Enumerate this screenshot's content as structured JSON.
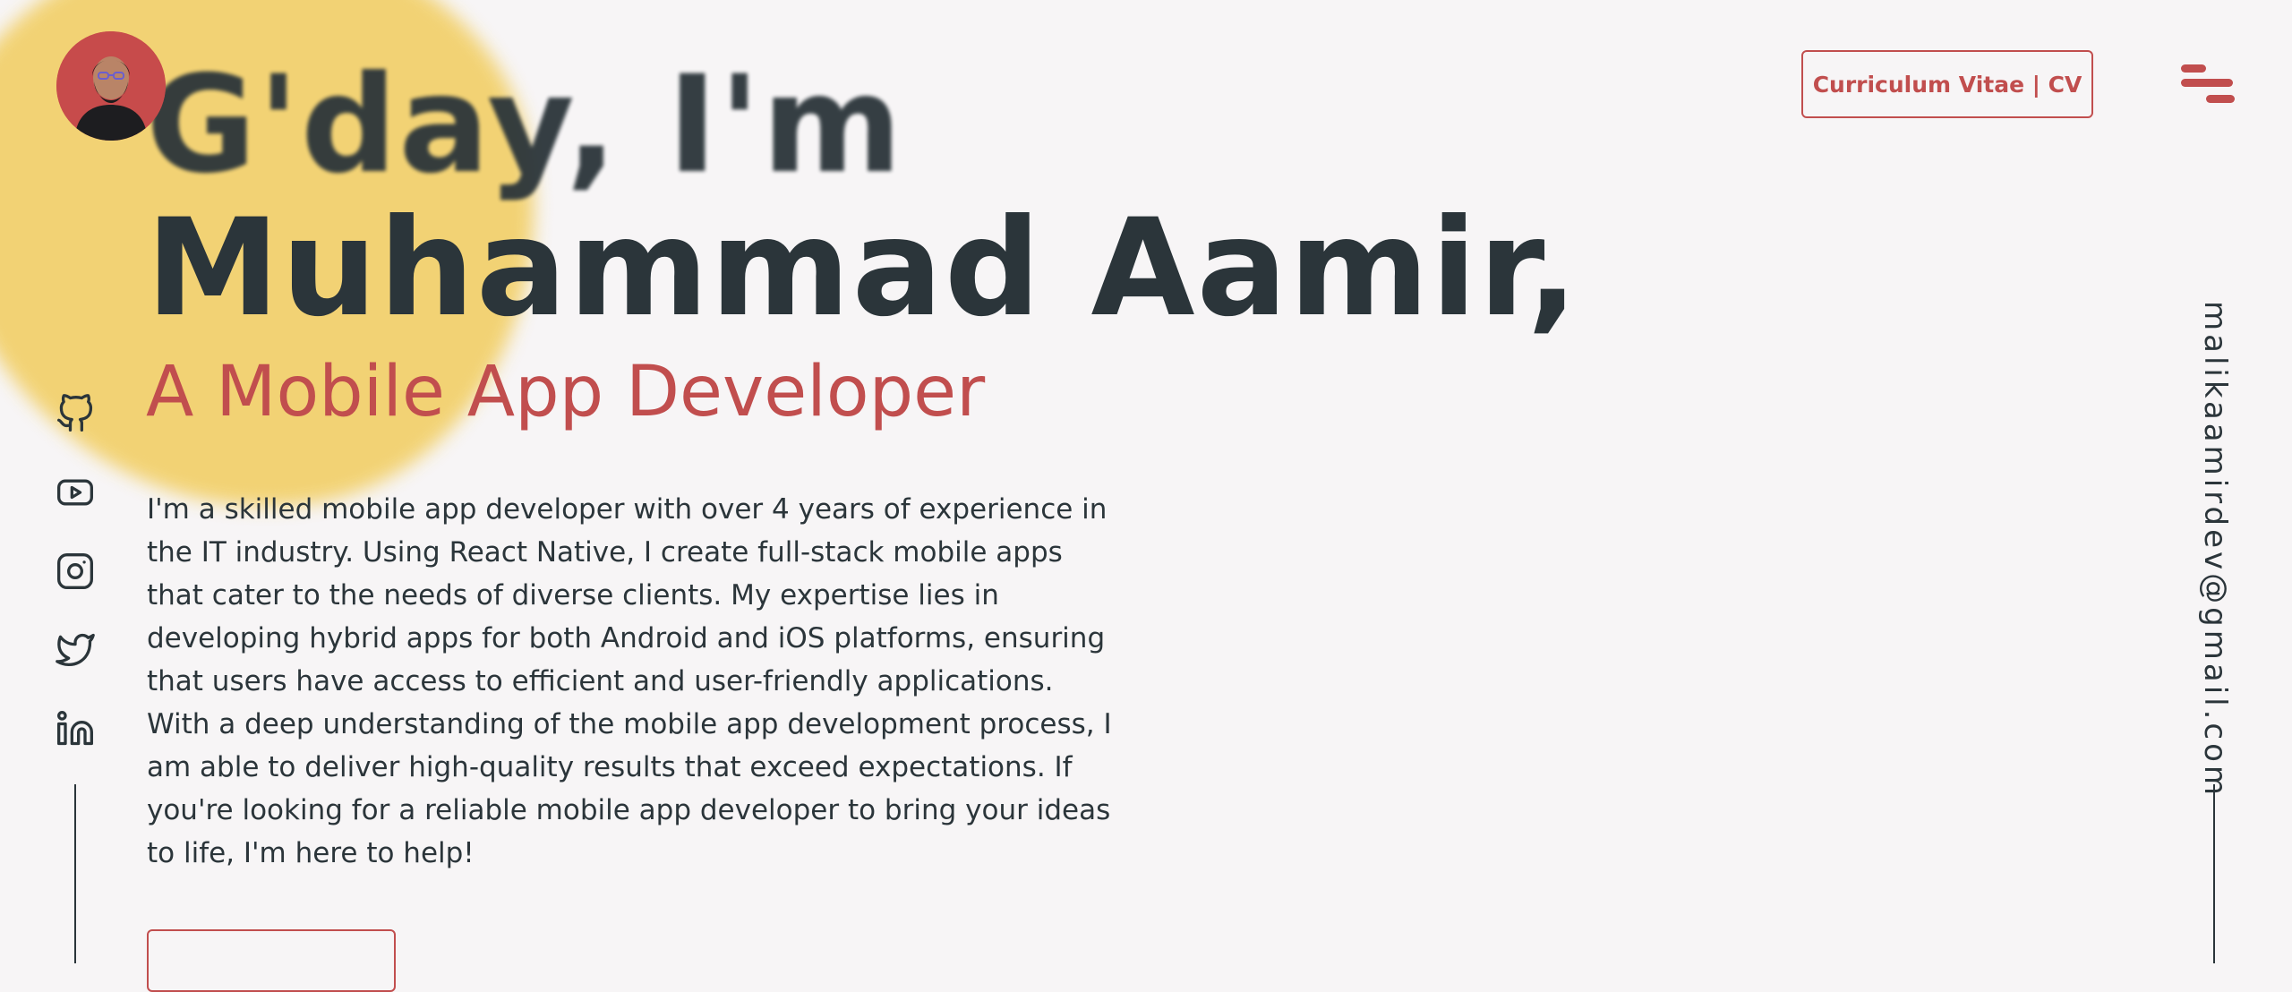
{
  "header": {
    "cv_label": "Curriculum Vitae | CV"
  },
  "hero": {
    "greeting": "G'day, I'm",
    "name": "Muhammad Aamir,",
    "role": "A Mobile App Developer",
    "bio": "I'm a skilled mobile app developer with over 4 years of experience in the IT industry. Using React Native, I create full-stack mobile apps that cater to the needs of diverse clients. My expertise lies in developing hybrid apps for both Android and iOS platforms, ensuring that users have access to efficient and user-friendly applications. With a deep understanding of the mobile app development process, I am able to deliver high-quality results that exceed expectations. If you're looking for a reliable mobile app developer to bring your ideas to life, I'm here to help!"
  },
  "contact": {
    "email": "malikaamirdev@gmail.com"
  },
  "social": {
    "icons": [
      "github-icon",
      "youtube-icon",
      "instagram-icon",
      "twitter-icon",
      "linkedin-icon"
    ]
  },
  "colors": {
    "background": "#f7f5f6",
    "accent": "#c14e4e",
    "text": "#2b353a",
    "blob": "#f2cf66"
  }
}
